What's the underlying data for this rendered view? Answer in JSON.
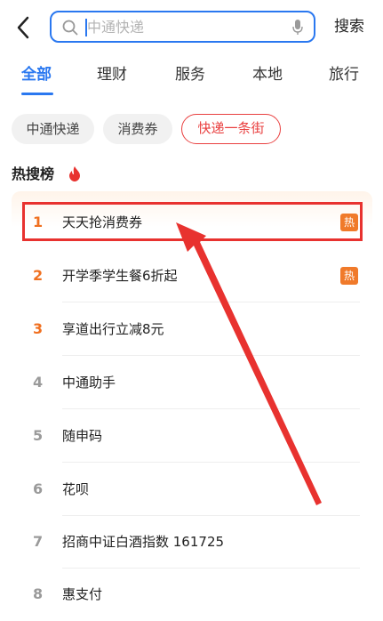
{
  "header": {
    "search_placeholder": "中通快递",
    "search_button": "搜索"
  },
  "tabs": [
    {
      "label": "全部",
      "active": true
    },
    {
      "label": "理财"
    },
    {
      "label": "服务"
    },
    {
      "label": "本地"
    },
    {
      "label": "旅行"
    }
  ],
  "history_chips": [
    "中通快递",
    "消费券",
    "快递一条街"
  ],
  "hot_list": {
    "title": "热搜榜",
    "badge_label": "热",
    "items": [
      {
        "rank": "1",
        "text": "天天抢消费券",
        "hot": true
      },
      {
        "rank": "2",
        "text": "开学季学生餐6折起",
        "hot": true
      },
      {
        "rank": "3",
        "text": "享道出行立减8元"
      },
      {
        "rank": "4",
        "text": "中通助手"
      },
      {
        "rank": "5",
        "text": "随申码"
      },
      {
        "rank": "6",
        "text": "花呗"
      },
      {
        "rank": "7",
        "text": "招商中证白酒指数 161725"
      },
      {
        "rank": "8",
        "text": "惠支付"
      }
    ]
  },
  "colors": {
    "accent": "#2a78f0",
    "hot_rank": "#f07020",
    "hot_badge": "#f07a2a",
    "annotation": "#e8322f"
  }
}
